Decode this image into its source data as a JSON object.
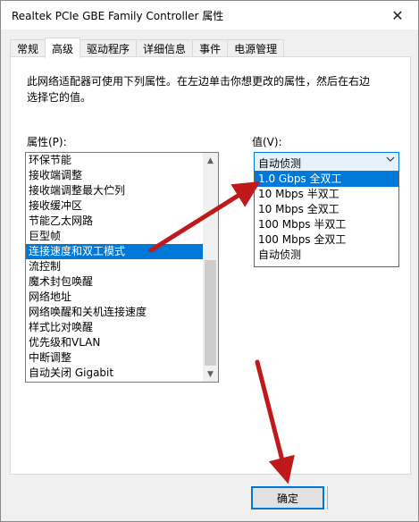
{
  "window": {
    "title": "Realtek PCIe GBE Family Controller 属性",
    "close_glyph": "✕"
  },
  "tabs": [
    {
      "label": "常规"
    },
    {
      "label": "高级",
      "active": true
    },
    {
      "label": "驱动程序"
    },
    {
      "label": "详细信息"
    },
    {
      "label": "事件"
    },
    {
      "label": "电源管理"
    }
  ],
  "description": "此网络适配器可使用下列属性。在左边单击你想更改的属性，然后在右边选择它的值。",
  "property_label": "属性(P):",
  "value_label": "值(V):",
  "properties": [
    {
      "label": "环保节能"
    },
    {
      "label": "接收端调整"
    },
    {
      "label": "接收端调整最大伫列"
    },
    {
      "label": "接收缓冲区"
    },
    {
      "label": "节能乙太网路"
    },
    {
      "label": "巨型帧"
    },
    {
      "label": "连接速度和双工模式",
      "selected": true
    },
    {
      "label": "流控制"
    },
    {
      "label": "魔术封包唤醒"
    },
    {
      "label": "网络地址"
    },
    {
      "label": "网络唤醒和关机连接速度"
    },
    {
      "label": "样式比对唤醒"
    },
    {
      "label": "优先级和VLAN"
    },
    {
      "label": "中断调整"
    },
    {
      "label": "自动关闭 Gigabit"
    }
  ],
  "value_combo": {
    "current": "自动侦测",
    "options": [
      {
        "label": "1.0 Gbps 全双工",
        "highlighted": true
      },
      {
        "label": "10 Mbps 半双工"
      },
      {
        "label": "10 Mbps 全双工"
      },
      {
        "label": "100 Mbps 半双工"
      },
      {
        "label": "100 Mbps 全双工"
      },
      {
        "label": "自动侦测"
      }
    ]
  },
  "ok_button": {
    "label": "确定"
  },
  "icons": {
    "combo_arrow": "chevron-down-icon",
    "scroll_up": "scroll-up-icon",
    "scroll_down": "scroll-down-icon"
  },
  "colors": {
    "selection": "#0078d7",
    "annotation_arrow": "#c0191c"
  }
}
